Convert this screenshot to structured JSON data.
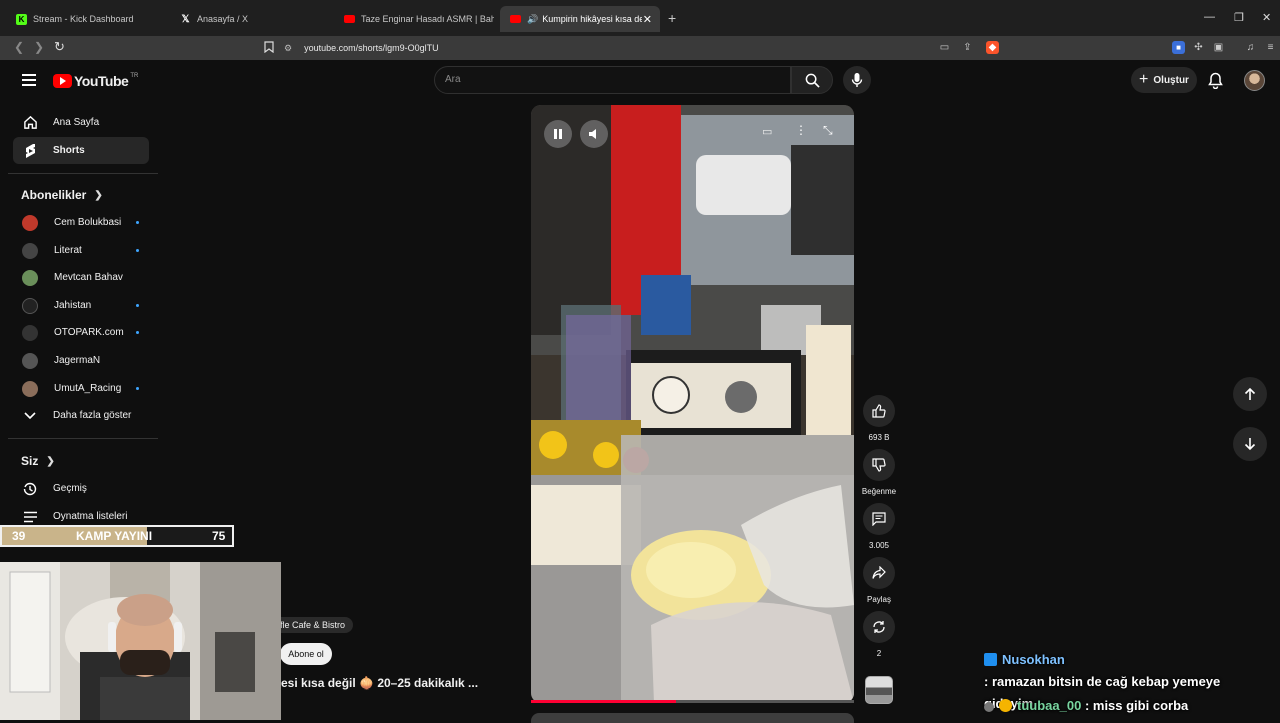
{
  "browser": {
    "tabs": [
      {
        "title": "Stream - Kick Dashboard",
        "icon": "kick-icon",
        "active": false
      },
      {
        "title": "Anasayfa / X",
        "icon": "x-icon",
        "active": false
      },
      {
        "title": "Taze Enginar Hasadı ASMR | Bahçede",
        "icon": "youtube-icon",
        "active": false
      },
      {
        "title": "Kumpirin hikâyesi kısa değil 🧅",
        "icon": "youtube-icon",
        "active": true
      }
    ],
    "url": "youtube.com/shorts/lgm9-O0glTU"
  },
  "youtube": {
    "logo_text": "YouTube",
    "logo_region": "TR",
    "search_placeholder": "Ara",
    "create_label": "Oluştur"
  },
  "sidebar": {
    "main": [
      {
        "label": "Ana Sayfa",
        "icon": "home-icon",
        "selected": false
      },
      {
        "label": "Shorts",
        "icon": "shorts-icon",
        "selected": true
      }
    ],
    "subscriptions_heading": "Abonelikler",
    "subscriptions": [
      {
        "label": "Cem Bolukbasi",
        "new": true,
        "color": "#c0392b"
      },
      {
        "label": "Literat",
        "new": true,
        "color": "#444444"
      },
      {
        "label": "Mevtcan Bahav",
        "new": false,
        "color": "#6a8f5a"
      },
      {
        "label": "Jahistan",
        "new": true,
        "color": "#222222"
      },
      {
        "label": "OTOPARK.com",
        "new": true,
        "color": "#333333"
      },
      {
        "label": "JagermaN",
        "new": false,
        "color": "#555555"
      },
      {
        "label": "UmutA_Racing",
        "new": true,
        "color": "#8a6d5a"
      }
    ],
    "show_more": "Daha fazla göster",
    "you_heading": "Siz",
    "you_items": [
      {
        "label": "Geçmiş",
        "icon": "history-icon"
      },
      {
        "label": "Oynatma listeleri",
        "icon": "playlist-icon"
      }
    ]
  },
  "short": {
    "channel_partial": "fle Cafe & Bistro",
    "subscribe_label": "Abone ol",
    "title_partial": "esi kısa değil 🧅 20–25 dakikalık ...",
    "progress_fraction": 0.45,
    "actions": {
      "like_count": "693 B",
      "dislike_label": "Beğenme",
      "comment_count": "3.005",
      "share_label": "Paylaş",
      "remix_count": "2"
    }
  },
  "overlay": {
    "left_number": "39",
    "title": "KAMP YAYINI",
    "right_number": "75"
  },
  "chat": [
    {
      "user": "Nusokhan",
      "message": ": ramazan bitsin de cağ kebap yemeye gideyim",
      "user_color": "#7ec1ff"
    },
    {
      "user": "tuubaa_00",
      "message": ": miss gibi corba",
      "user_color": "#79d5a0"
    }
  ],
  "colors": {
    "background": "#0f0f0f",
    "accent_red": "#ff0000",
    "progress": "#ff0033",
    "new_dot": "#3ea6ff"
  }
}
